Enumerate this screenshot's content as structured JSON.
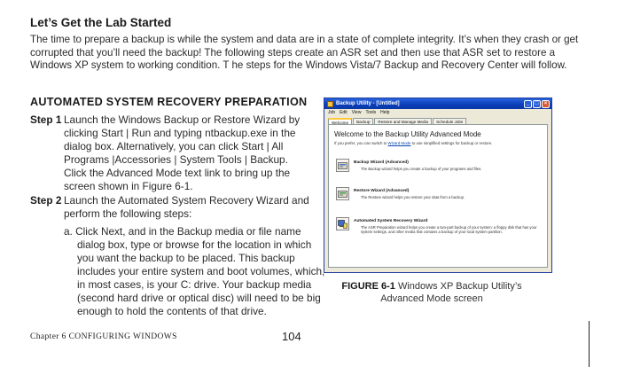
{
  "heading_lab": "Let’s Get the Lab Started",
  "intro_paragraph": "The time to prepare a backup is while the system and data are in a state of complete integrity. It’s when they crash or get corrupted that you’ll need the backup! The following steps create an ASR set and then use that ASR set to restore a Windows XP system to working condition. T he steps for the Windows Vista/7 Backup and Recovery Center will follow.",
  "heading_asr": "AUTOMATED SYSTEM RECOVERY PREPARATION",
  "step1": {
    "label": "Step 1",
    "text": "Launch the Windows Backup or Restore Wizard by clicking Start | Run and typing ntbackup.exe in the dialog box. Alternatively, you can click Start | All Programs |Accessories | System Tools | Backup. Click the Advanced Mode text link to bring up the screen shown in Figure 6-1."
  },
  "step2": {
    "label": "Step 2",
    "text": "Launch the Automated System Recovery Wizard and perform the following steps:",
    "substep_a": "a. Click Next, and in the Backup media or file name dialog box, type or browse for the location in which you want the backup to be placed. This backup includes your entire system and boot volumes, which, in most cases, is your C: drive. Your backup media (second hard drive or optical disc) will need to be big enough to hold the contents of that drive."
  },
  "figure": {
    "label": "FIGURE 6-1",
    "caption": "Windows XP Backup Utility’s Advanced Mode screen",
    "window": {
      "title": "Backup Utility - [Untitled]",
      "menu": [
        "Job",
        "Edit",
        "View",
        "Tools",
        "Help"
      ],
      "tabs": [
        "Welcome",
        "Backup",
        "Restore and Manage Media",
        "Schedule Jobs"
      ],
      "welcome_title": "Welcome to the Backup Utility Advanced Mode",
      "welcome_sub_pre": "If you prefer, you can switch to",
      "welcome_sub_link": "Wizard Mode",
      "welcome_sub_post": "to use simplified settings for backup or restore.",
      "options": [
        {
          "title": "Backup Wizard (Advanced)",
          "desc": "The Backup wizard helps you create a backup of your programs and files."
        },
        {
          "title": "Restore Wizard (Advanced)",
          "desc": "The Restore wizard helps you restore your data from a backup."
        },
        {
          "title": "Automated System Recovery Wizard",
          "desc": "The ASR Preparation wizard helps you create a two-part backup of your system: a floppy disk that has your system settings, and other media that contains a backup of your local system partition."
        }
      ]
    }
  },
  "footer": {
    "chapter": "Chapter 6 CONFIGURING WINDOWS",
    "page_number": "104"
  }
}
